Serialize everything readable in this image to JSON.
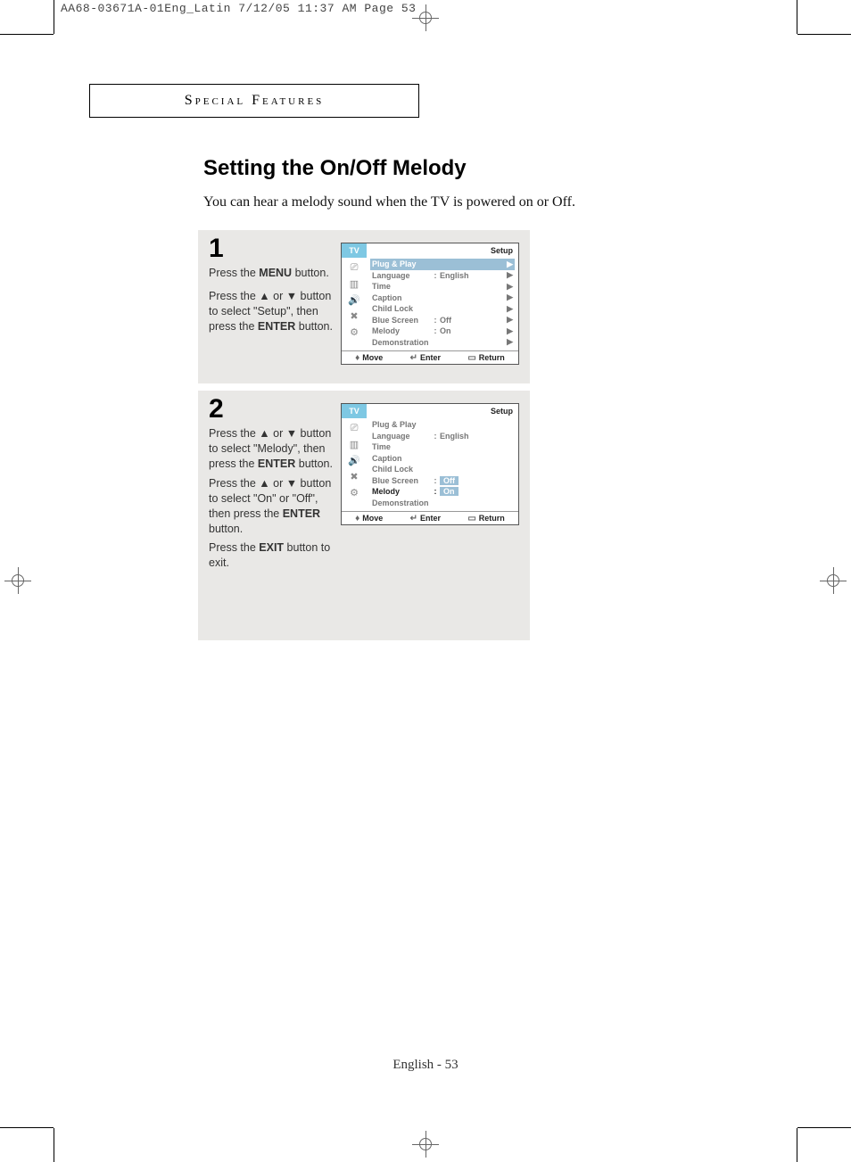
{
  "print_header": "AA68-03671A-01Eng_Latin  7/12/05  11:37 AM  Page 53",
  "section_header": "Special Features",
  "title": "Setting the On/Off Melody",
  "subtitle": "You can hear a melody sound when the TV is powered on or Off.",
  "page_number": "English - 53",
  "step1": {
    "num": "1",
    "line_a": "Press the <b>MENU</b> button.",
    "line_b": "Press the ▲ or ▼ button to select \"Setup\", then press the <b>ENTER</b> button."
  },
  "step2": {
    "num": "2",
    "line_a": "Press the ▲ or ▼ button to select \"Melody\", then press the <b>ENTER</b> button.",
    "line_b": "Press the ▲ or ▼ button to select \"On\" or \"Off\", then press the <b>ENTER</b> button.",
    "line_c": "Press the <b>EXIT</b> button to exit."
  },
  "osd": {
    "tv": "TV",
    "title": "Setup",
    "rows": {
      "plug": "Plug & Play",
      "language": "Language",
      "language_val": "English",
      "time": "Time",
      "caption": "Caption",
      "childlock": "Child Lock",
      "bluescreen": "Blue Screen",
      "bluescreen_val": "Off",
      "melody": "Melody",
      "melody_val": "On",
      "demo": "Demonstration"
    },
    "foot": {
      "move": "Move",
      "enter": "Enter",
      "ret": "Return"
    }
  }
}
